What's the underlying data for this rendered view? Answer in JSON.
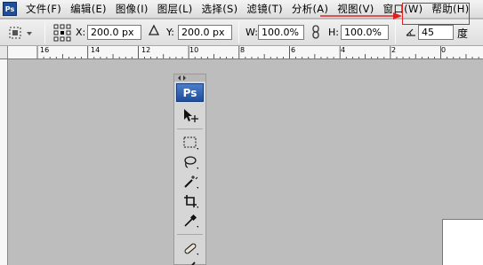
{
  "menu": {
    "logo": "Ps",
    "items": [
      "文件(F)",
      "编辑(E)",
      "图像(I)",
      "图层(L)",
      "选择(S)",
      "滤镜(T)",
      "分析(A)",
      "视图(V)",
      "窗口(W)",
      "帮助(H)"
    ]
  },
  "options": {
    "x_label": "X:",
    "x_value": "200.0 px",
    "y_label": "Y:",
    "y_value": "200.0 px",
    "w_label": "W:",
    "w_value": "100.0%",
    "h_label": "H:",
    "h_value": "100.0%",
    "angle_value": "45",
    "angle_unit": "度",
    "highlight_color": "#e02020"
  },
  "ruler": {
    "labels": [
      "16",
      "14",
      "12",
      "10",
      "8",
      "6",
      "4",
      "2",
      "0"
    ]
  },
  "toolbox": {
    "title": "Ps",
    "tools": [
      "move-tool-icon",
      "marquee-tool-icon",
      "lasso-tool-icon",
      "magic-wand-tool-icon",
      "crop-tool-icon",
      "eyedropper-tool-icon",
      "healing-brush-tool-icon",
      "brush-tool-icon"
    ]
  }
}
